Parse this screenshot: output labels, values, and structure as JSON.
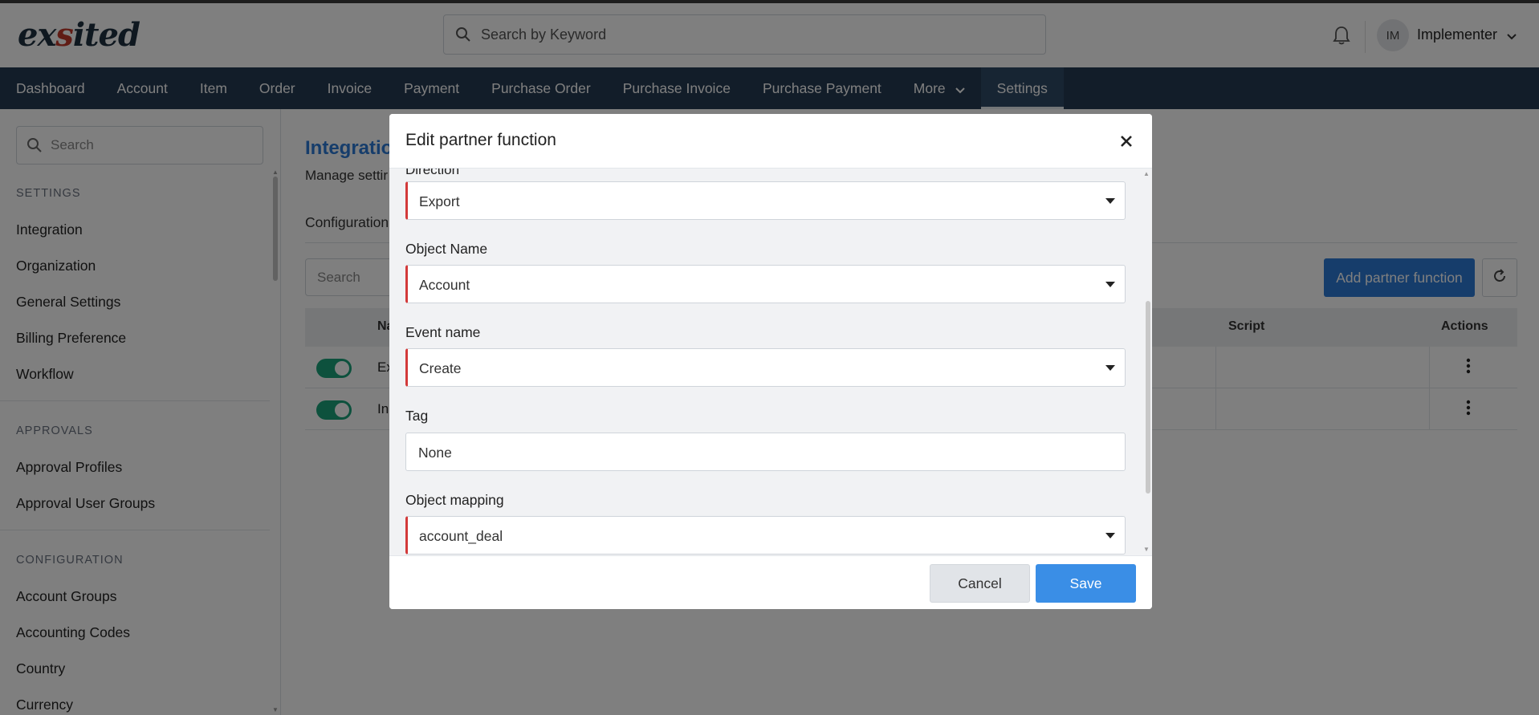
{
  "header": {
    "logo": {
      "part1": "ex",
      "accent": "s",
      "part2": "ited"
    },
    "search_placeholder": "Search by Keyword",
    "user": {
      "initials": "IM",
      "name": "Implementer"
    }
  },
  "nav": {
    "items": [
      "Dashboard",
      "Account",
      "Item",
      "Order",
      "Invoice",
      "Payment",
      "Purchase Order",
      "Purchase Invoice",
      "Purchase Payment",
      "More",
      "Settings"
    ],
    "active": "Settings"
  },
  "sidebar": {
    "search_placeholder": "Search",
    "sections": [
      {
        "heading": "SETTINGS",
        "items": [
          "Integration",
          "Organization",
          "General Settings",
          "Billing Preference",
          "Workflow"
        ]
      },
      {
        "heading": "APPROVALS",
        "items": [
          "Approval Profiles",
          "Approval User Groups"
        ]
      },
      {
        "heading": "CONFIGURATION",
        "items": [
          "Account Groups",
          "Accounting Codes",
          "Country",
          "Currency"
        ]
      }
    ]
  },
  "main": {
    "title": "Integratio",
    "subtitle": "Manage settir",
    "tab": "Configuration",
    "search_placeholder": "Search",
    "add_button": "Add partner function",
    "table": {
      "columns": [
        "Na",
        "Script",
        "Actions"
      ],
      "rows": [
        {
          "name": "Ex",
          "enabled": true
        },
        {
          "name": "In",
          "enabled": true
        }
      ]
    }
  },
  "modal": {
    "title": "Edit partner function",
    "clipped_label": "Direction",
    "fields": [
      {
        "label": "",
        "value": "Export",
        "type": "select"
      },
      {
        "label": "Object Name",
        "value": "Account",
        "type": "select"
      },
      {
        "label": "Event name",
        "value": "Create",
        "type": "select"
      },
      {
        "label": "Tag",
        "value": "None",
        "type": "input"
      },
      {
        "label": "Object mapping",
        "value": "account_deal",
        "type": "select"
      }
    ],
    "cancel_label": "Cancel",
    "save_label": "Save"
  },
  "colors": {
    "nav_bg": "#243a52",
    "accent_blue": "#2c7ad6",
    "save_blue": "#3a8ee6",
    "required_red": "#d33a3a",
    "toggle_green": "#1aa37a"
  }
}
